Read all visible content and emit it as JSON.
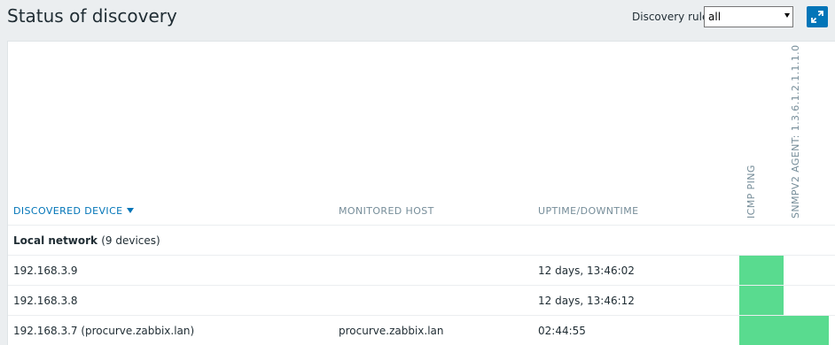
{
  "page": {
    "title": "Status of discovery",
    "filter_label": "Discovery rule",
    "filter_value": "all",
    "fullscreen_icon": "fullscreen-icon"
  },
  "table": {
    "headers": {
      "device": "DISCOVERED DEVICE",
      "host": "MONITORED HOST",
      "uptime": "UPTIME/DOWNTIME",
      "check1": "ICMP PING",
      "check2": "SNMPV2 AGENT: 1.3.6.1.2.1.1.1.0"
    },
    "group": {
      "name": "Local network",
      "count": "(9 devices)"
    },
    "rows": [
      {
        "device": "192.168.3.9",
        "host": "",
        "uptime": "12 days, 13:46:02",
        "icmp": "up",
        "snmp": ""
      },
      {
        "device": "192.168.3.8",
        "host": "",
        "uptime": "12 days, 13:46:12",
        "icmp": "up",
        "snmp": ""
      },
      {
        "device": "192.168.3.7 (procurve.zabbix.lan)",
        "host": "procurve.zabbix.lan",
        "uptime": "02:44:55",
        "icmp": "up",
        "snmp": "up"
      }
    ]
  },
  "colors": {
    "status_up": "#59db8f",
    "accent": "#0275b8"
  }
}
